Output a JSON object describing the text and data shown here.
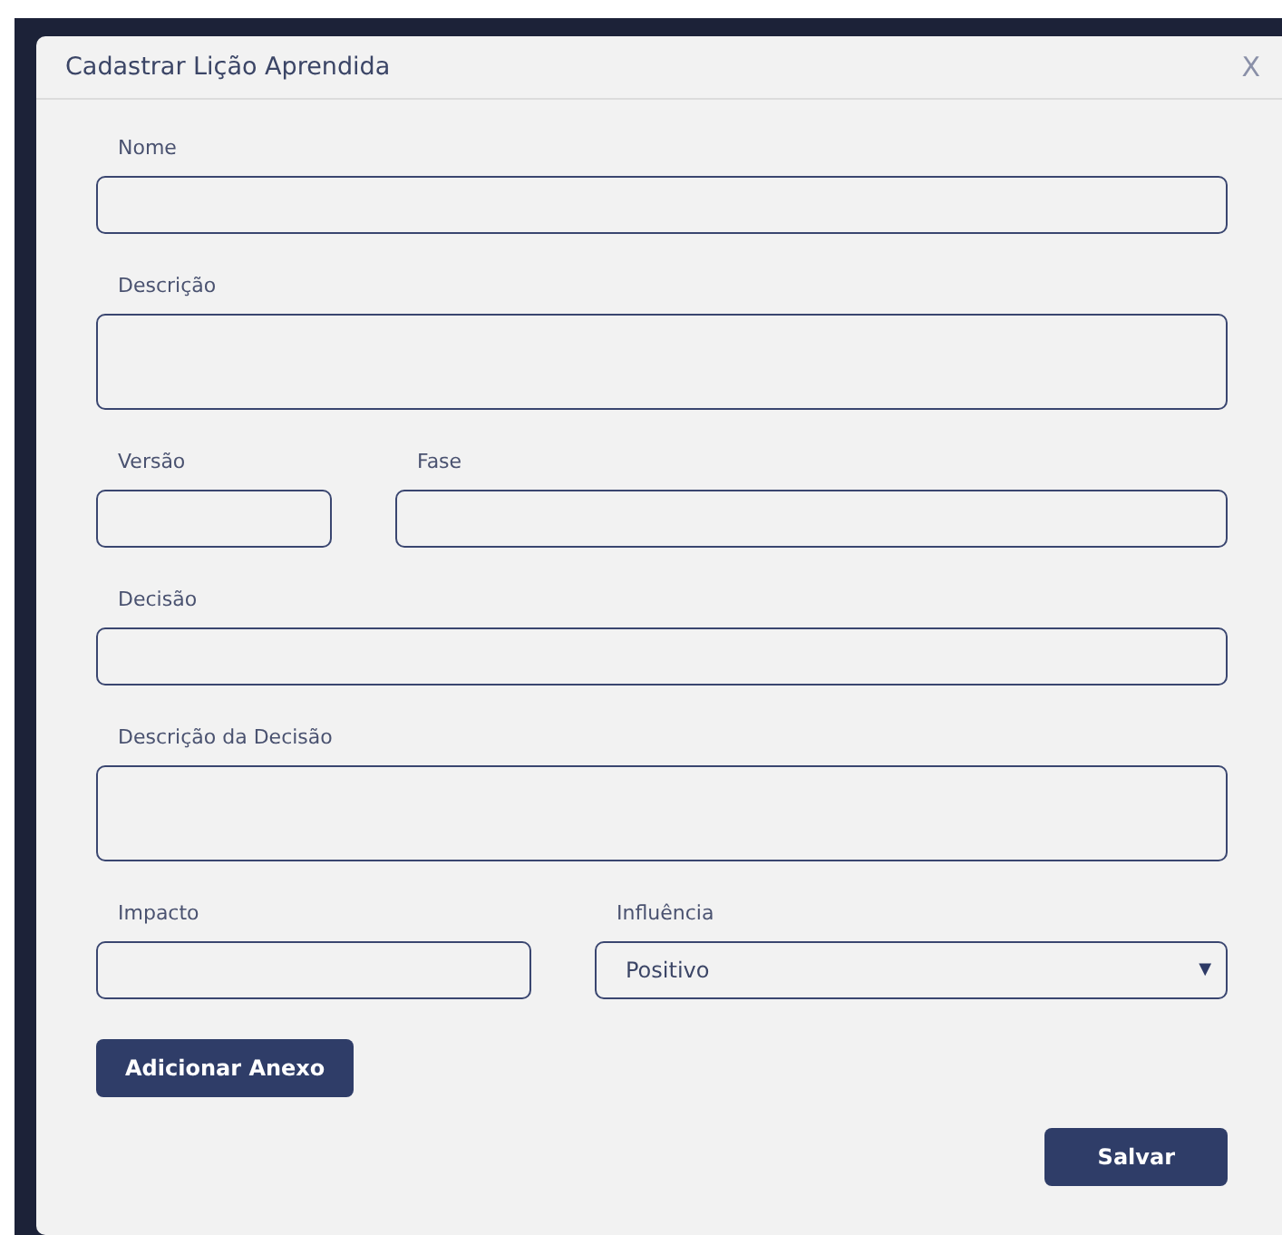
{
  "dialog": {
    "title": "Cadastrar Lição Aprendida",
    "close": "X"
  },
  "rows": [
    {
      "fields": [
        {
          "label": "Nome",
          "kind": "input"
        }
      ]
    },
    {
      "fields": [
        {
          "label": "Descrição",
          "kind": "textarea"
        }
      ]
    },
    {
      "fields": [
        {
          "label": "Versão",
          "kind": "input"
        },
        {
          "label": "Fase",
          "kind": "input"
        }
      ]
    },
    {
      "fields": [
        {
          "label": "Decisão",
          "kind": "input"
        }
      ]
    },
    {
      "fields": [
        {
          "label": "Descrição da Decisão",
          "kind": "textarea"
        }
      ]
    },
    {
      "fields": [
        {
          "label": "Impacto",
          "kind": "input"
        },
        {
          "label": "Influência",
          "kind": "select",
          "value": "Positivo",
          "arrow": "▼"
        }
      ]
    }
  ],
  "attach_button": "Adicionar Anexo",
  "save_button": "Salvar"
}
